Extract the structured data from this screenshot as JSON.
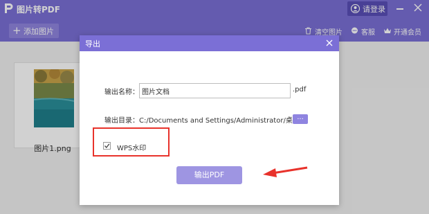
{
  "app": {
    "title": "图片转PDF",
    "login_label": "请登录",
    "logo_icon": "app-logo-icon"
  },
  "toolbar": {
    "add_label": "添加图片",
    "add_symbol": "+",
    "clear_label": "清空图片",
    "service_label": "客服",
    "vip_label": "开通会员"
  },
  "thumbnail": {
    "filename": "图片1.png"
  },
  "dialog": {
    "title": "导出",
    "name_label": "输出名称：",
    "name_value": "图片文档",
    "name_ext": ".pdf",
    "dir_label": "输出目录：C:/Documents and Settings/Administrator/桌面",
    "browse_label": "...",
    "watermark_label": "WPS水印",
    "watermark_checked": true,
    "export_label": "输出PDF"
  },
  "colors": {
    "brand": "#7b6fd6",
    "button": "#9e95e2",
    "highlight": "#e8322b"
  }
}
